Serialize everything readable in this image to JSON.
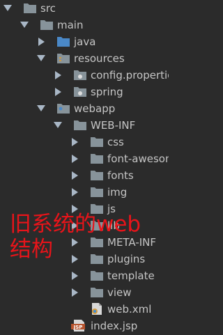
{
  "tree": {
    "items": [
      {
        "label": "src",
        "depth": 0,
        "expanded": true,
        "icon": "folder-icon"
      },
      {
        "label": "main",
        "depth": 1,
        "expanded": true,
        "icon": "folder-icon"
      },
      {
        "label": "java",
        "depth": 2,
        "expanded": false,
        "icon": "source-folder-icon"
      },
      {
        "label": "resources",
        "depth": 2,
        "expanded": true,
        "icon": "resources-folder-icon"
      },
      {
        "label": "config.properties",
        "depth": 3,
        "expanded": false,
        "icon": "package-folder-icon"
      },
      {
        "label": "spring",
        "depth": 3,
        "expanded": false,
        "icon": "package-folder-icon"
      },
      {
        "label": "webapp",
        "depth": 2,
        "expanded": true,
        "icon": "web-folder-icon"
      },
      {
        "label": "WEB-INF",
        "depth": 3,
        "expanded": true,
        "icon": "folder-icon"
      },
      {
        "label": "css",
        "depth": 4,
        "expanded": false,
        "icon": "folder-icon"
      },
      {
        "label": "font-awesome",
        "depth": 4,
        "expanded": false,
        "icon": "folder-icon"
      },
      {
        "label": "fonts",
        "depth": 4,
        "expanded": false,
        "icon": "folder-icon"
      },
      {
        "label": "img",
        "depth": 4,
        "expanded": false,
        "icon": "folder-icon"
      },
      {
        "label": "js",
        "depth": 4,
        "expanded": false,
        "icon": "folder-icon"
      },
      {
        "label": "lib",
        "depth": 4,
        "expanded": false,
        "icon": "folder-icon"
      },
      {
        "label": "META-INF",
        "depth": 4,
        "expanded": false,
        "icon": "folder-icon"
      },
      {
        "label": "plugins",
        "depth": 4,
        "expanded": false,
        "icon": "folder-icon"
      },
      {
        "label": "template",
        "depth": 4,
        "expanded": false,
        "icon": "folder-icon"
      },
      {
        "label": "view",
        "depth": 4,
        "expanded": false,
        "icon": "folder-icon"
      },
      {
        "label": "web.xml",
        "depth": 4,
        "expanded": null,
        "icon": "web-xml-file-icon"
      },
      {
        "label": "index.jsp",
        "depth": 3,
        "expanded": null,
        "icon": "jsp-file-icon"
      }
    ]
  },
  "annotation": "旧系统的web\n结构",
  "colors": {
    "background": "#2b2b2b",
    "text": "#c5c5c5",
    "arrow": "#a9b7c6",
    "folder": "#87939a",
    "source_folder": "#4a88c7",
    "annotation": "#e8141a"
  }
}
